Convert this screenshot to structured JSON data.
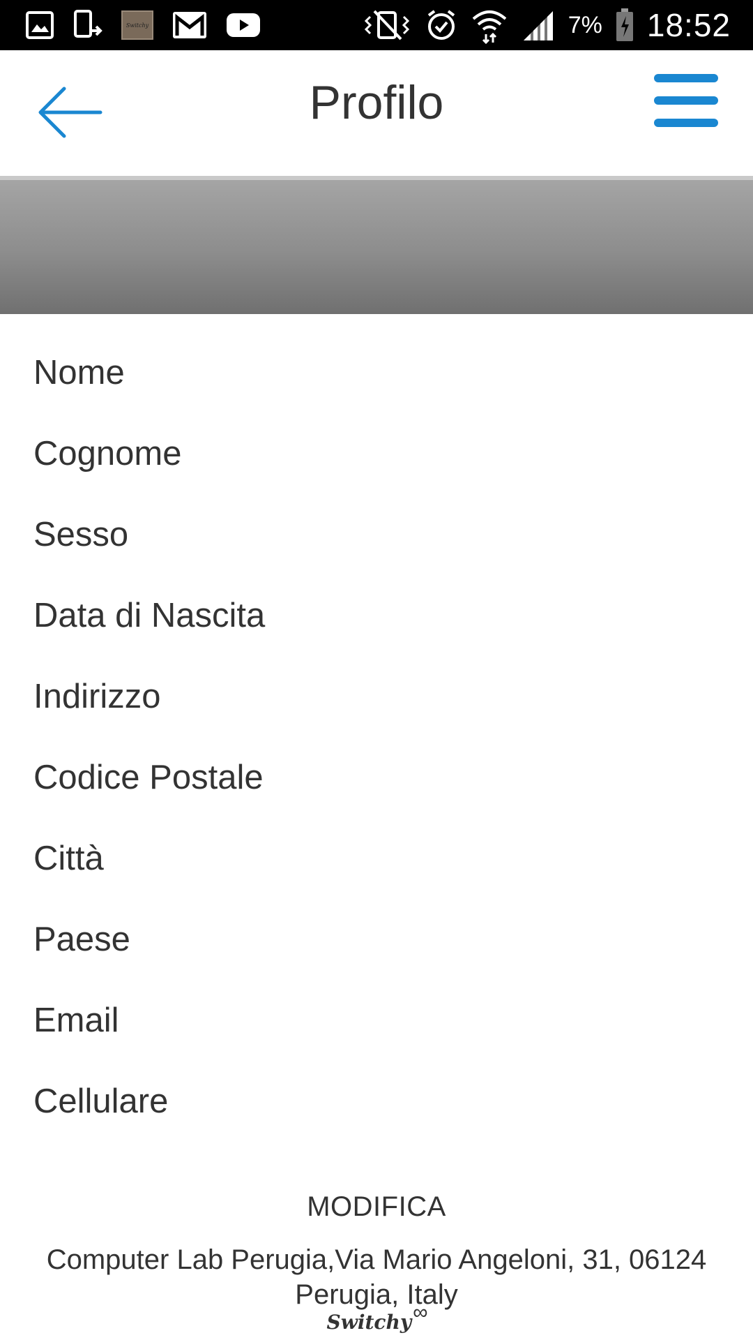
{
  "status_bar": {
    "battery_percent": "7%",
    "time": "18:52",
    "left_icons": [
      "gallery-icon",
      "phone-transfer-icon",
      "app-thumbnail",
      "gmail-icon",
      "youtube-icon"
    ],
    "right_icons": [
      "vibrate-mute-icon",
      "alarm-icon",
      "wifi-icon",
      "signal-icon",
      "battery-icon"
    ],
    "thumbnail_label": "Switchy"
  },
  "header": {
    "title": "Profilo",
    "accent_color": "#1a87d1"
  },
  "profile_fields": [
    {
      "label": "Nome"
    },
    {
      "label": "Cognome"
    },
    {
      "label": "Sesso"
    },
    {
      "label": "Data di Nascita"
    },
    {
      "label": "Indirizzo"
    },
    {
      "label": "Codice Postale"
    },
    {
      "label": "Città"
    },
    {
      "label": "Paese"
    },
    {
      "label": "Email"
    },
    {
      "label": "Cellulare"
    }
  ],
  "footer": {
    "edit_label": "MODIFICA",
    "address_line1": "Computer Lab Perugia,Via Mario Angeloni, 31, 06124",
    "address_line2": "Perugia, Italy",
    "brand": "Switchy",
    "brand_symbol": "∞"
  }
}
